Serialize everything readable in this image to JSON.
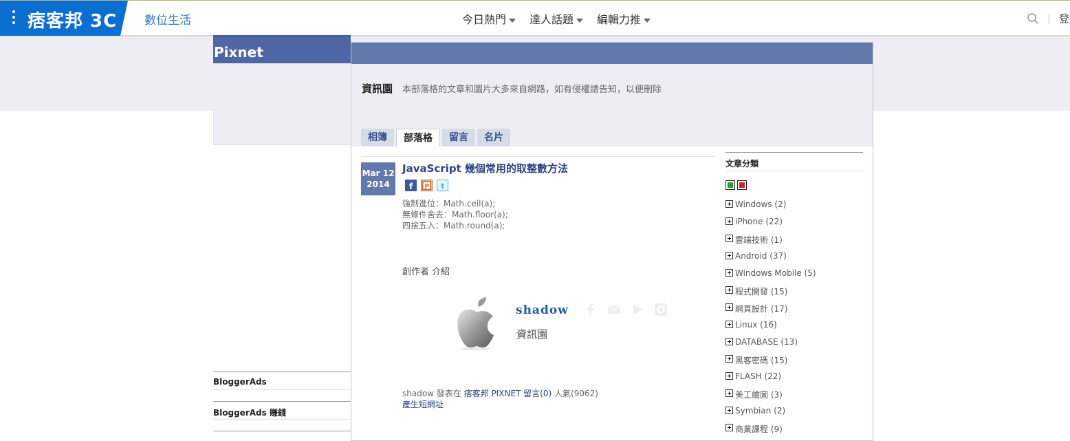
{
  "topbar": {
    "logo_text": "痞客邦 3C",
    "channel": "數位生活",
    "nav": [
      {
        "label": "今日熱門"
      },
      {
        "label": "達人話題"
      },
      {
        "label": "編輯力推"
      }
    ],
    "login": "登入"
  },
  "brand_band": {
    "label": "Pixnet"
  },
  "blog": {
    "name": "資訊園",
    "description": "本部落格的文章和圖片大多來自網路，如有侵權請告知，以便刪除"
  },
  "tabs": [
    "相簿",
    "部落格",
    "留言",
    "名片"
  ],
  "active_tab": "部落格",
  "post": {
    "date_month_day": "Mar 12",
    "date_year": "2014",
    "title": "JavaScript 幾個常用的取整數方法",
    "share": [
      "facebook",
      "plurk",
      "twitter"
    ],
    "body_lines": [
      "強制進位：Math.ceil(a);",
      "無條件舍去：Math.floor(a);",
      "四捨五入：Math.round(a);"
    ],
    "author_heading": "創作者 介紹"
  },
  "author": {
    "name": "shadow",
    "blog": "資訊園",
    "avatar_icon": "apple-logo",
    "social_icons": [
      "facebook-icon",
      "mail-icon",
      "play-icon",
      "instagram-icon"
    ]
  },
  "meta": {
    "prefix": "shadow 發表在 ",
    "site_link": "痞客邦 PIXNET",
    "comments": "留言(0)",
    "views": "人氣(9062)",
    "short_url": "產生短網址"
  },
  "sidebar": {
    "title": "文章分類",
    "categories": [
      "Windows (2)",
      "iPhone (22)",
      "雲端技術 (1)",
      "Android (37)",
      "Windows Mobile (5)",
      "程式開發 (15)",
      "網頁設計 (17)",
      "Linux (16)",
      "DATABASE (13)",
      "黑客密碼 (15)",
      "FLASH (22)",
      "美工繪圖 (3)",
      "Symbian (2)",
      "商業課程 (9)"
    ]
  },
  "left_ads": [
    "BloggerAds",
    "BloggerAds 賺錢"
  ],
  "colors": {
    "brand_blue": "#0a6fd1",
    "header_blue": "#6379ac",
    "band_blue": "#4e66a3",
    "link_blue": "#2b4482"
  }
}
